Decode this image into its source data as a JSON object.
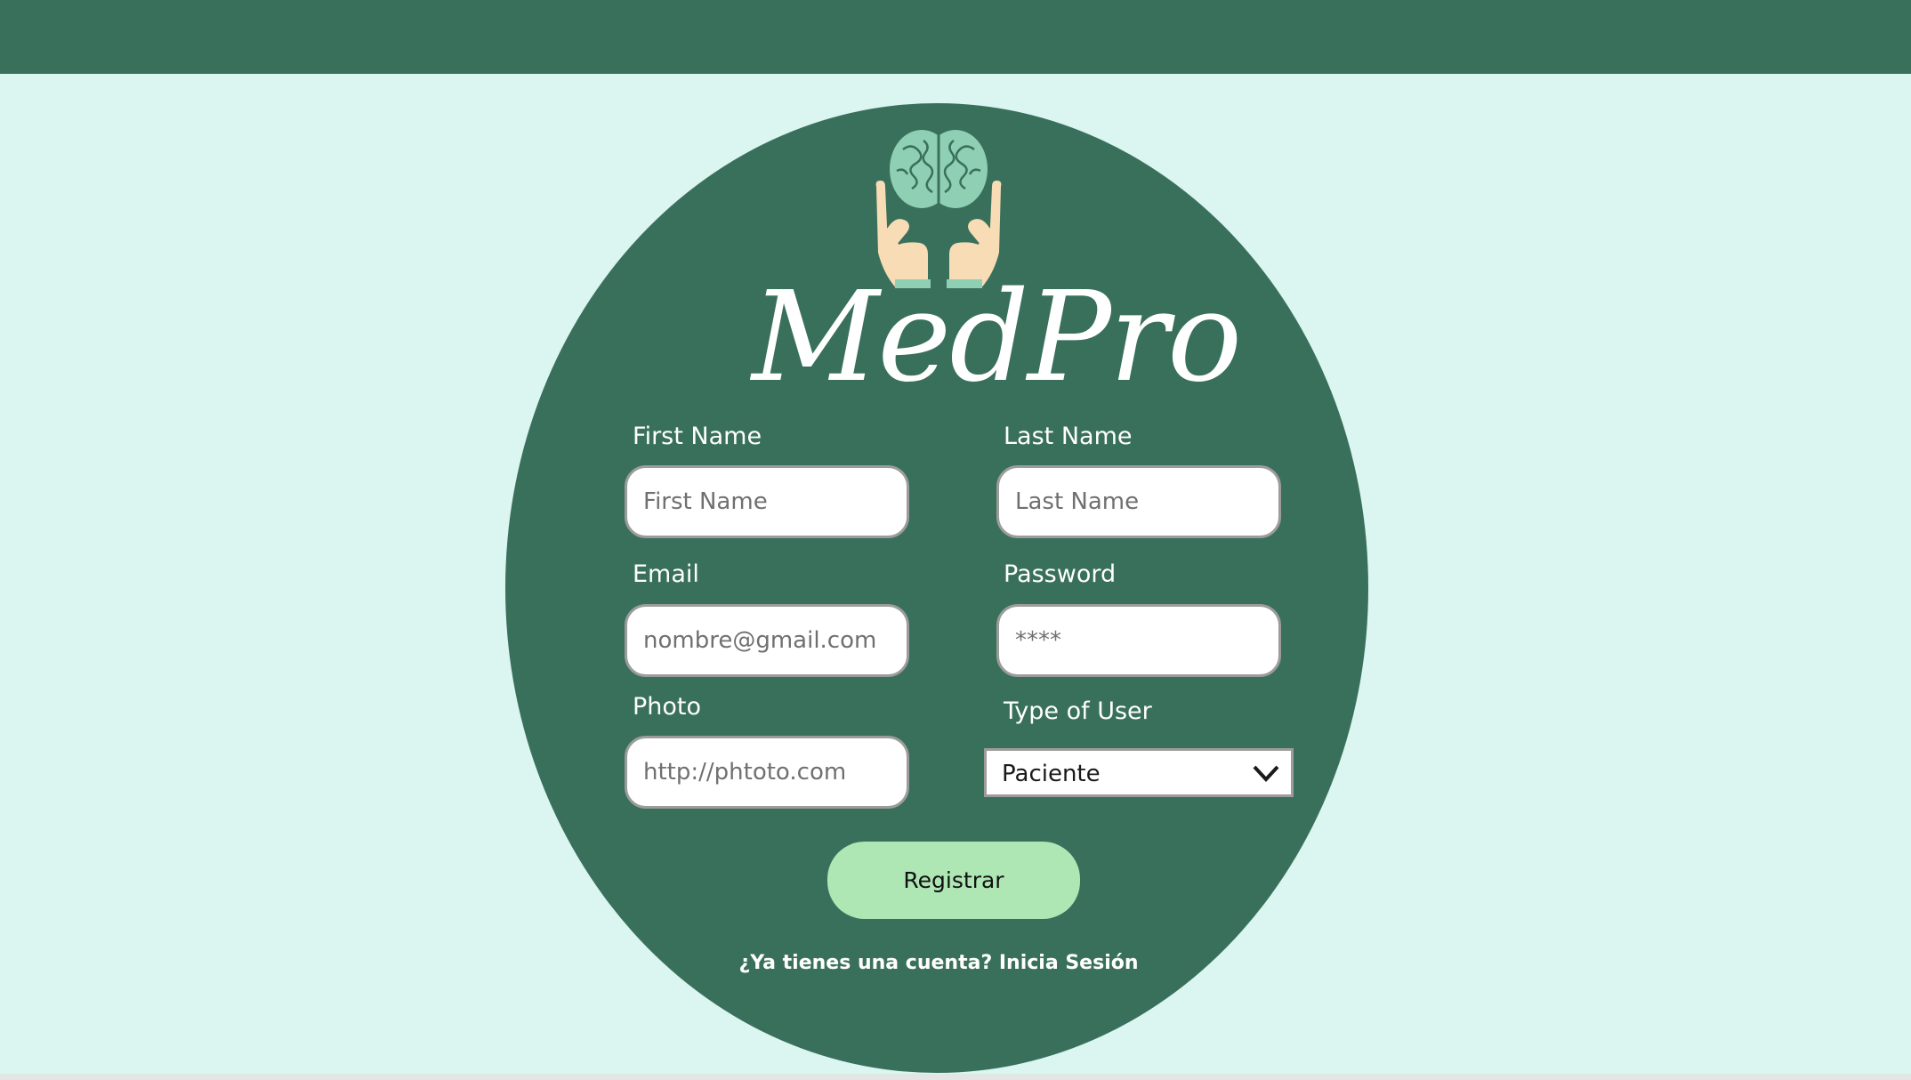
{
  "brand": {
    "name": "MedPro",
    "logo_icon": "brain-in-hands-icon"
  },
  "form": {
    "first_name": {
      "label": "First Name",
      "placeholder": "First Name",
      "value": ""
    },
    "last_name": {
      "label": "Last Name",
      "placeholder": "Last Name",
      "value": ""
    },
    "email": {
      "label": "Email",
      "placeholder": "nombre@gmail.com",
      "value": ""
    },
    "password": {
      "label": "Password",
      "placeholder": "****",
      "value": ""
    },
    "photo": {
      "label": "Photo",
      "placeholder": "http://phtoto.com",
      "value": ""
    },
    "user_type": {
      "label": "Type of User",
      "selected": "Paciente",
      "icon": "chevron-down-icon"
    },
    "submit_label": "Registrar",
    "login_prompt": "¿Ya tienes una cuenta? Inicia Sesión"
  },
  "colors": {
    "page_background": "#dbf5f1",
    "header": "#39705c",
    "card": "#39705c",
    "button": "#aee6b4",
    "brain": "#8fcfb3",
    "hands": "#f7dcb6"
  }
}
